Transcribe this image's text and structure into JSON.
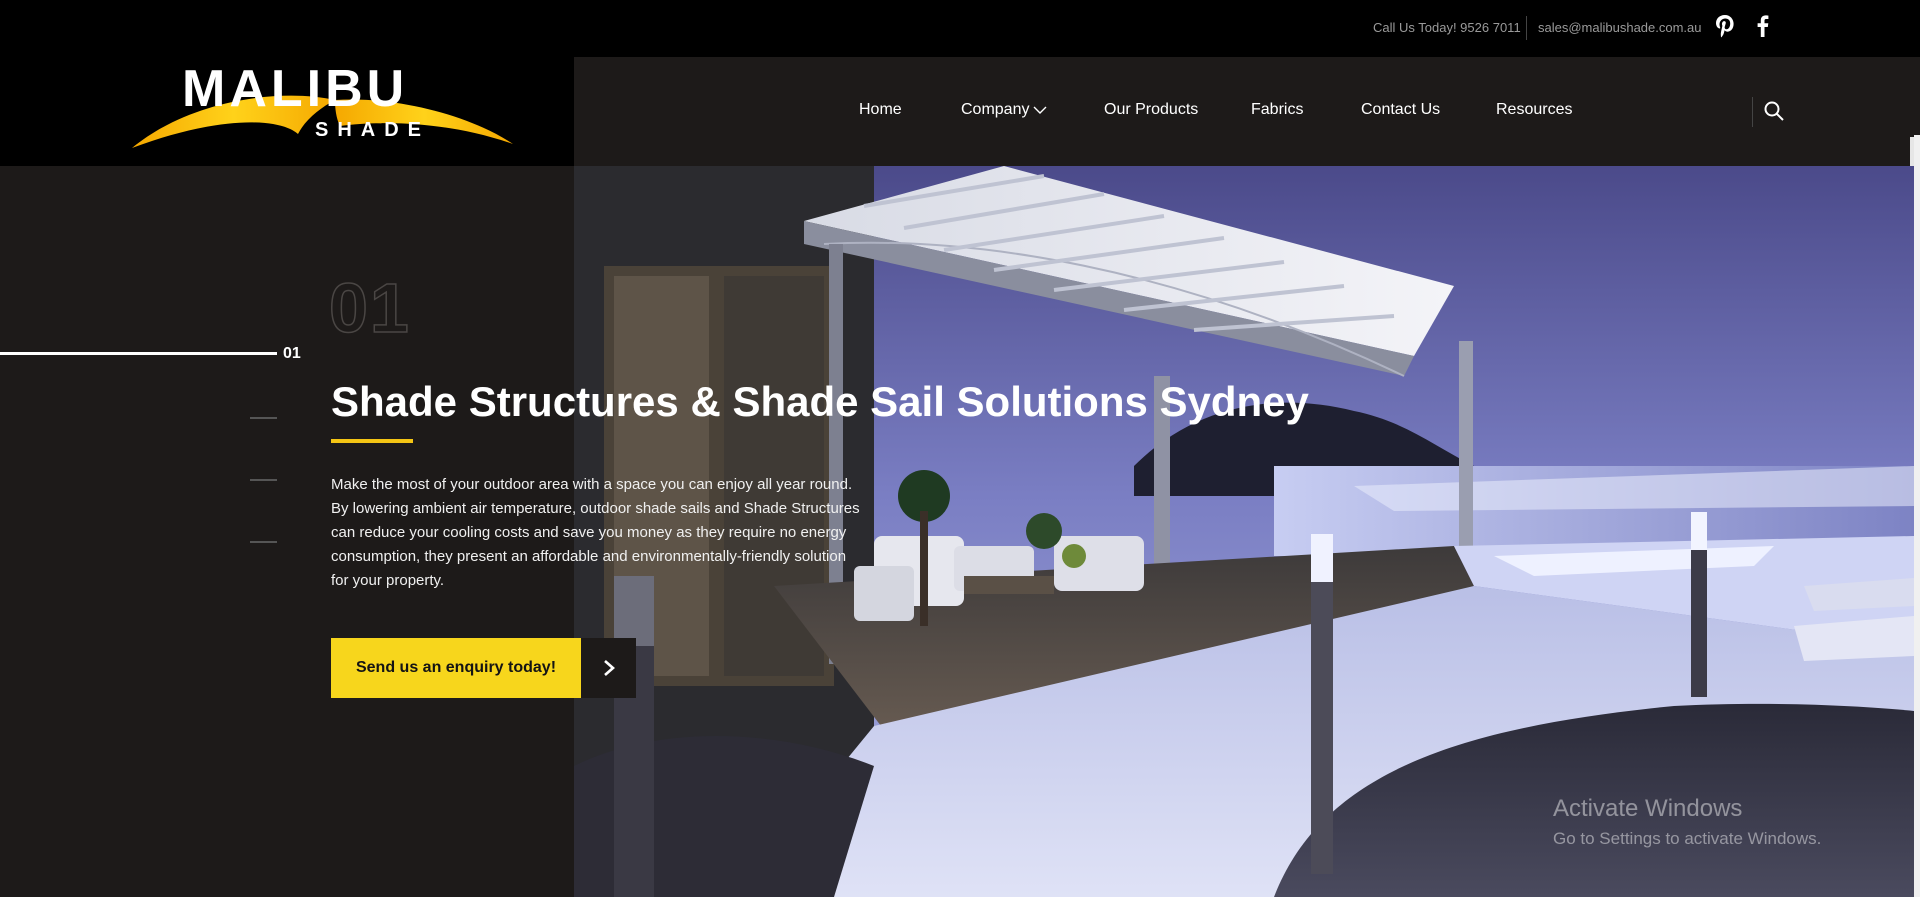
{
  "topbar": {
    "call": "Call Us Today! 9526 7011",
    "email": "sales@malibushade.com.au",
    "social": [
      "pinterest-icon",
      "facebook-icon"
    ]
  },
  "logo": {
    "top": "MALIBU",
    "bottom": "SHADE"
  },
  "nav": {
    "items": [
      "Home",
      "Company",
      "Our Products",
      "Fabrics",
      "Contact Us",
      "Resources"
    ],
    "search_icon": "search-icon"
  },
  "slider": {
    "big_number": "01",
    "active_label": "01",
    "title": "Shade Structures & Shade Sail Solutions Sydney",
    "description": "Make the most of your outdoor area with a space you can enjoy all year round. By lowering ambient air temperature, outdoor shade sails and Shade Structures can reduce your cooling costs and save you money as they require no energy consumption, they present an affordable and environmentally-friendly solution for your property.",
    "cta": "Send us an enquiry today!"
  },
  "watermark": {
    "title": "Activate Windows",
    "subtitle": "Go to Settings to activate Windows."
  },
  "colors": {
    "accent": "#f7d61c",
    "panel": "#1d1a19",
    "background": "#000000"
  }
}
